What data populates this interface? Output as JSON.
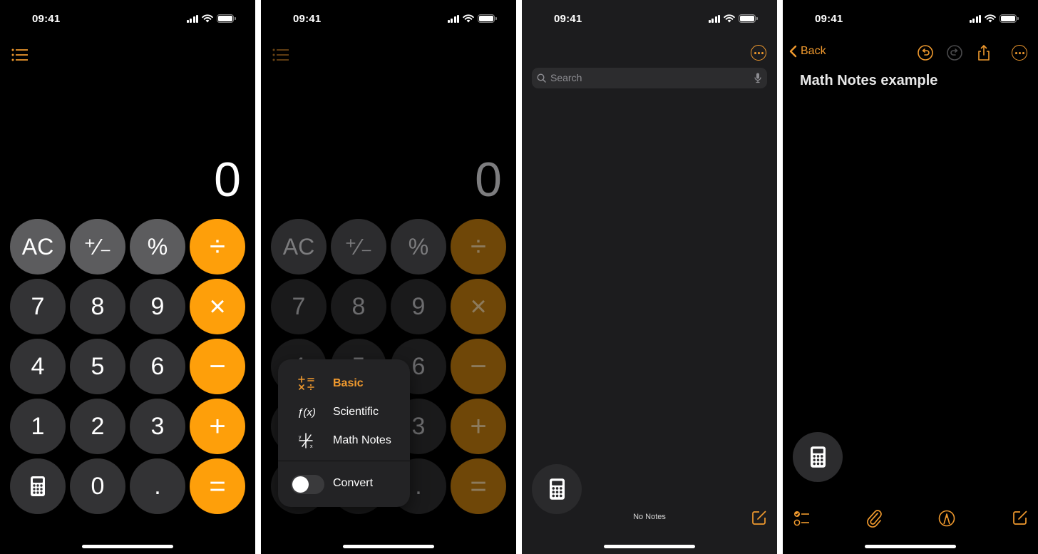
{
  "status_bar": {
    "time": "09:41"
  },
  "colors": {
    "accent": "#fe9f0a",
    "tint": "#f19a2e",
    "function_key": "#5c5c5e",
    "number_key": "#333335",
    "notes_bg": "#1c1c1e"
  },
  "calculator": {
    "display": "0",
    "menu_icon": "list-bullet-icon",
    "keys": [
      [
        "AC",
        "⁺∕₋",
        "%",
        "÷"
      ],
      [
        "7",
        "8",
        "9",
        "×"
      ],
      [
        "4",
        "5",
        "6",
        "−"
      ],
      [
        "1",
        "2",
        "3",
        "+"
      ],
      [
        "calculator-icon",
        "0",
        ".",
        "="
      ]
    ]
  },
  "mode_menu": {
    "items": [
      {
        "label": "Basic",
        "icon": "basic-operators-icon",
        "selected": true
      },
      {
        "label": "Scientific",
        "icon": "function-icon",
        "selected": false
      },
      {
        "label": "Math Notes",
        "icon": "math-notes-icon",
        "selected": false
      }
    ],
    "convert": {
      "label": "Convert",
      "enabled": false
    }
  },
  "notes_list": {
    "search_placeholder": "Search",
    "empty_text": "No Notes"
  },
  "note_editor": {
    "back_label": "Back",
    "title": "Math Notes example",
    "toolbar": [
      "checklist-icon",
      "paperclip-icon",
      "markup-pen-icon",
      "compose-icon"
    ]
  }
}
